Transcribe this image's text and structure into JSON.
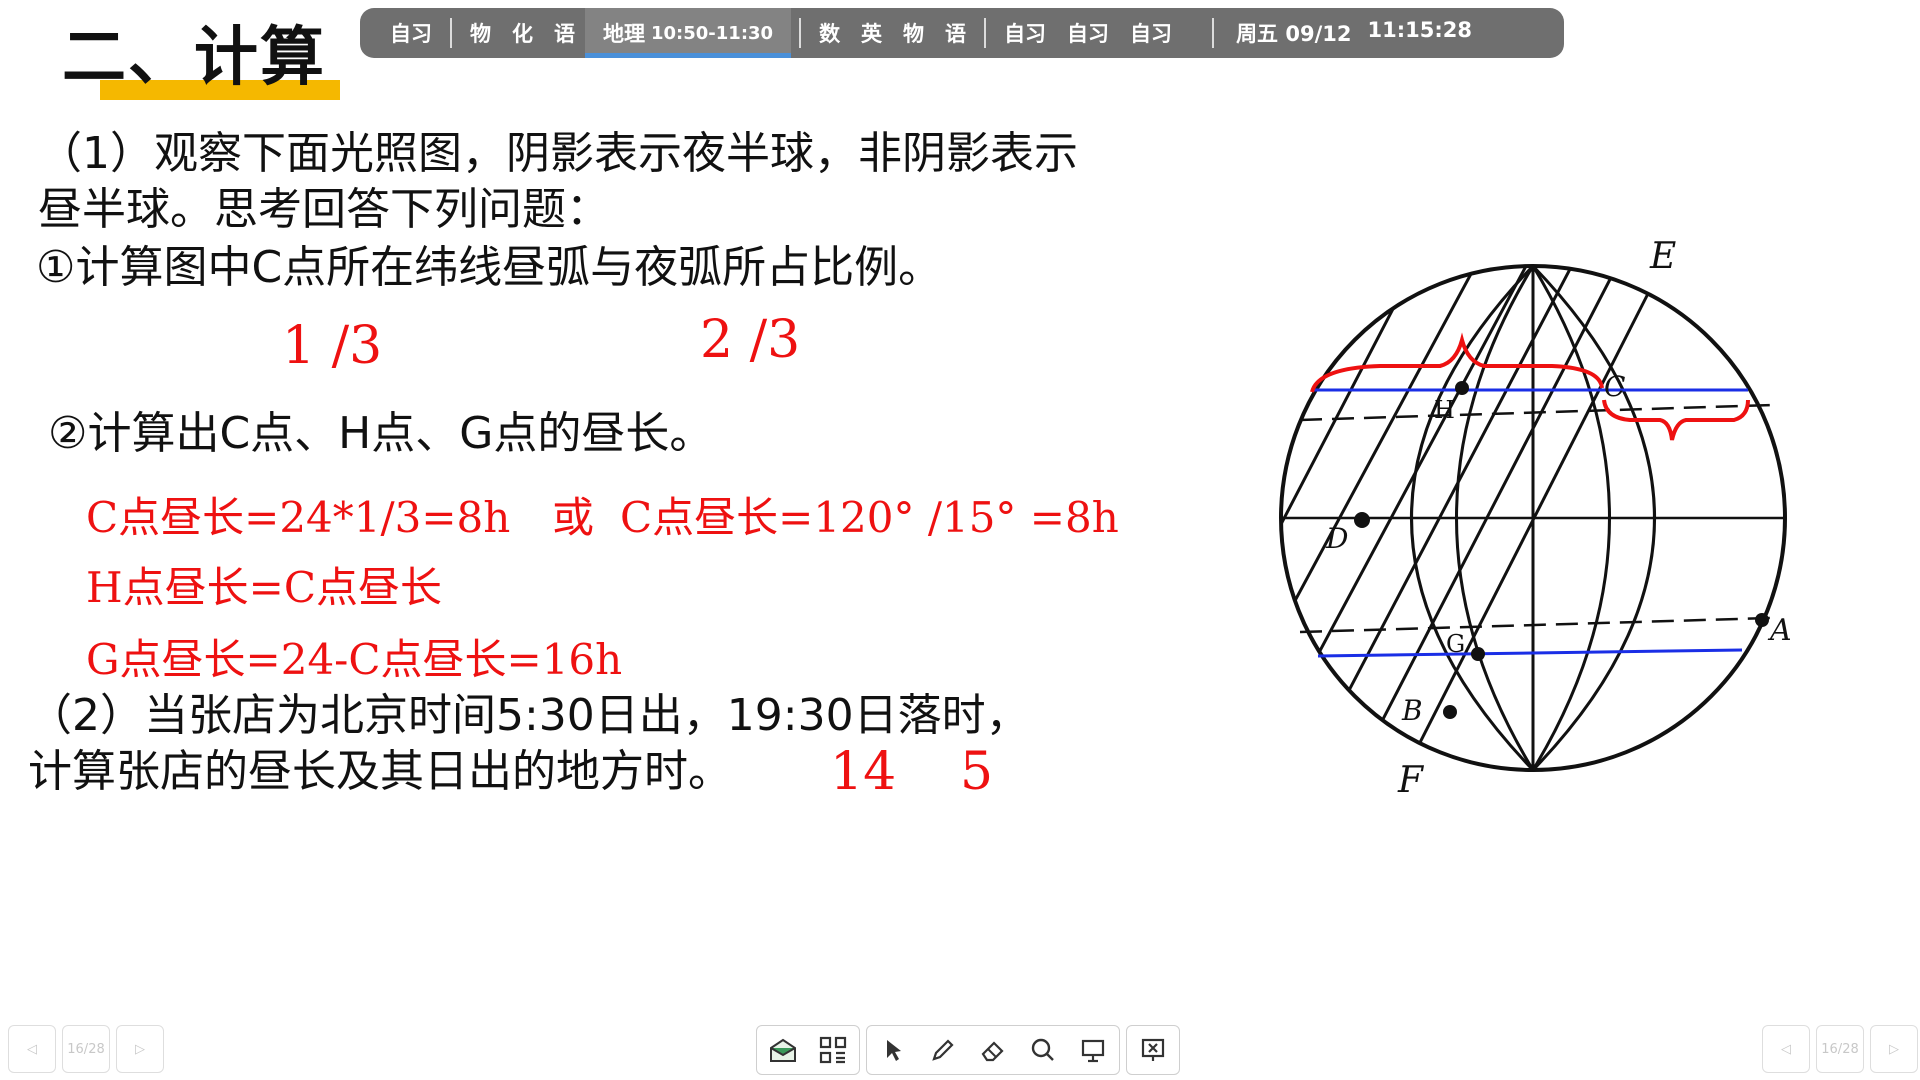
{
  "title": "二、计算",
  "schedule": {
    "items": [
      {
        "label": "自习"
      },
      {
        "label": "物　化　语"
      },
      {
        "label": "地理",
        "time": "10:50-11:30",
        "active": true
      },
      {
        "label": "数　英　物　语"
      },
      {
        "label": "自习　自习　自习"
      }
    ],
    "date": "周五 09/12",
    "clock": "11:15:28"
  },
  "q1": {
    "line1": "（1）观察下面光照图，阴影表示夜半球，非阴影表示",
    "line2": "昼半球。思考回答下列问题：",
    "sub1": "①计算图中C点所在纬线昼弧与夜弧所占比例。",
    "ans1a": "1 /3",
    "ans1b": "2 /3",
    "sub2": "②计算出C点、H点、G点的昼长。",
    "ans2a": "C点昼长=24*1/3=8h",
    "ans2or": "或",
    "ans2b": "C点昼长=120° /15° =8h",
    "ans2c": "H点昼长=C点昼长",
    "ans2d": "G点昼长=24-C点昼长=16h"
  },
  "q2": {
    "line1": "（2）当张店为北京时间5:30日出，19:30日落时，",
    "line2": "计算张店的昼长及其日出的地方时。",
    "ans_a": "14",
    "ans_b": "5"
  },
  "diagram": {
    "labels": {
      "E": "E",
      "F": "F",
      "A": "A",
      "B": "B",
      "C": "C",
      "D": "D",
      "G": "G",
      "H": "H"
    }
  },
  "page": {
    "indicator": "16/28"
  }
}
